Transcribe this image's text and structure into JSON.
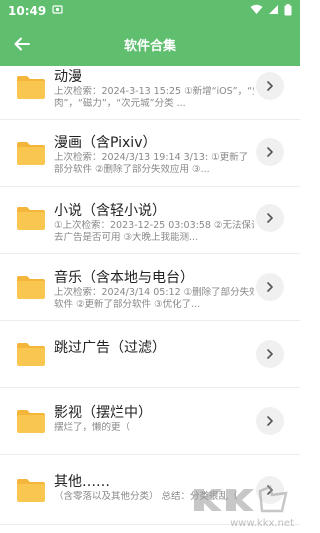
{
  "status": {
    "time": "10:49"
  },
  "header": {
    "title": "软件合集"
  },
  "items": [
    {
      "title": "动漫",
      "desc1": "上次检索：2024-3-13 15:25 ①新增“iOS”，“生",
      "desc2": "肉”，“磁力”，“次元城”分类 ..."
    },
    {
      "title": "漫画（含Pixiv）",
      "desc1": "上次检索：2024/3/13 19:14 3/13: ①更新了",
      "desc2": "部分软件 ②删除了部分失效应用 ③..."
    },
    {
      "title": "小说（含轻小说）",
      "desc1": "①上次检索：2023-12-25 03:03:58 ②无法保证",
      "desc2": "去广告是否可用 ③大晚上我能测..."
    },
    {
      "title": "音乐（含本地与电台）",
      "desc1": "上次检索：2024/3/14 05:12 ①删除了部分失效",
      "desc2": "软件 ②更新了部分软件 ③优化了..."
    },
    {
      "title": "跳过广告（过滤）",
      "desc1": "",
      "desc2": ""
    },
    {
      "title": "影视（摆烂中）",
      "desc1": "摆烂了，懒的更（",
      "desc2": ""
    },
    {
      "title": "其他……",
      "desc1": "（含零落以及其他分类） 总结：分类很乱（",
      "desc2": ""
    }
  ],
  "watermark": {
    "text": "www.kkx.net"
  },
  "colors": {
    "brand": "#5fbf6f",
    "folder": "#f9c74f",
    "folder_tab": "#f4b63a"
  }
}
